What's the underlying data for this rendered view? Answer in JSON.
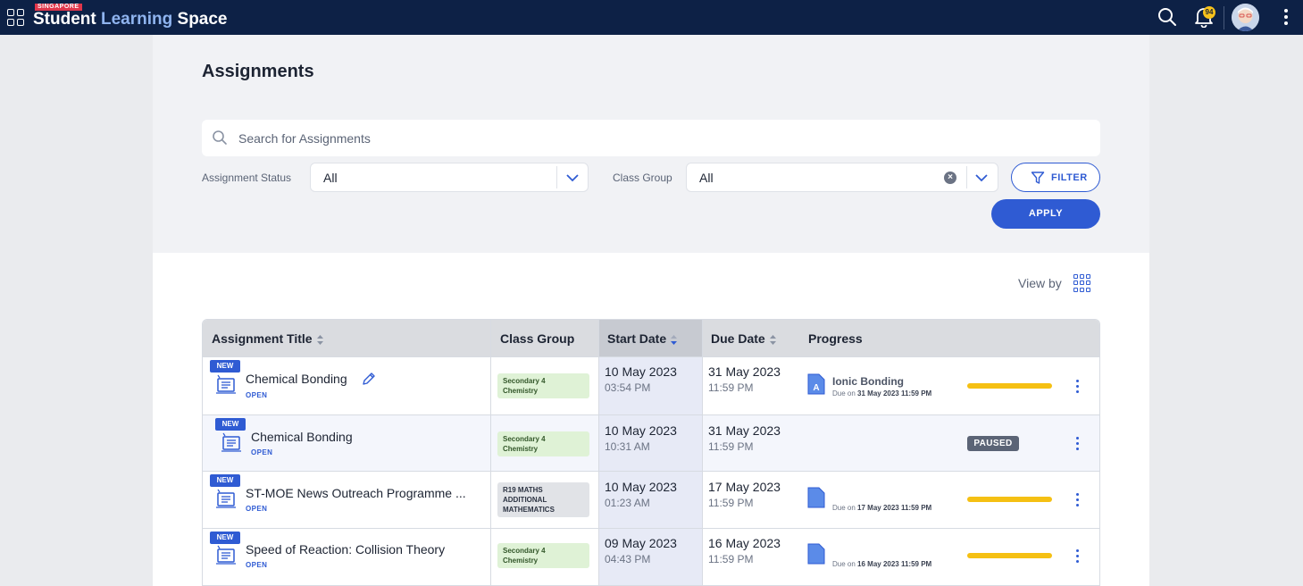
{
  "app": {
    "brand_tag": "SINGAPORE",
    "brand_part1": "Student ",
    "brand_part2": "Learning ",
    "brand_part3": "Space",
    "notification_count": "94"
  },
  "page": {
    "title": "Assignments",
    "search_placeholder": "Search for Assignments"
  },
  "filters": {
    "status_label": "Assignment Status",
    "status_value": "All",
    "class_label": "Class Group",
    "class_value": "All",
    "filter_label": "FILTER",
    "apply_label": "APPLY"
  },
  "view": {
    "label": "View by"
  },
  "table": {
    "headers": {
      "title": "Assignment Title",
      "class_group": "Class Group",
      "start_date": "Start Date",
      "due_date": "Due Date",
      "progress": "Progress"
    },
    "rows": [
      {
        "badge": "NEW",
        "title": "Chemical Bonding",
        "status": "OPEN",
        "class_group": [
          "Secondary 4",
          "Chemistry"
        ],
        "start_date": "10 May 2023",
        "start_time": "03:54 PM",
        "due_date": "31 May 2023",
        "due_time": "11:59 PM",
        "progress_title": "Ionic Bonding",
        "progress_due_prefix": "Due on ",
        "progress_due": "31 May 2023 11:59 PM",
        "progress_icon_letter": "A"
      },
      {
        "badge": "NEW",
        "title": "Chemical Bonding",
        "status": "OPEN",
        "class_group": [
          "Secondary 4",
          "Chemistry"
        ],
        "start_date": "10 May 2023",
        "start_time": "10:31 AM",
        "due_date": "31 May 2023",
        "due_time": "11:59 PM",
        "paused_label": "PAUSED"
      },
      {
        "badge": "NEW",
        "title": "ST-MOE News Outreach Programme ...",
        "status": "OPEN",
        "class_group": [
          "R19 MATHS",
          "ADDITIONAL",
          "MATHEMATICS"
        ],
        "start_date": "10 May 2023",
        "start_time": "01:23 AM",
        "due_date": "17 May 2023",
        "due_time": "11:59 PM",
        "progress_due_prefix": "Due on ",
        "progress_due": "17 May 2023 11:59 PM"
      },
      {
        "badge": "NEW",
        "title": "Speed of Reaction: Collision Theory",
        "status": "OPEN",
        "class_group": [
          "Secondary 4",
          "Chemistry"
        ],
        "start_date": "09 May 2023",
        "start_time": "04:43 PM",
        "due_date": "16 May 2023",
        "due_time": "11:59 PM",
        "progress_due_prefix": "Due on ",
        "progress_due": "16 May 2023 11:59 PM"
      }
    ]
  },
  "colors": {
    "topbar": "#0d2146",
    "accent": "#2f5bd3",
    "progress": "#f5c013",
    "badge_new": "#2f5bd3"
  }
}
